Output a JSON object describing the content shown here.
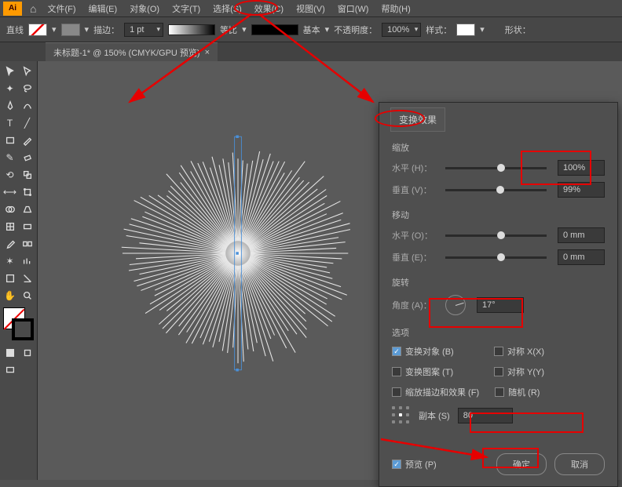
{
  "app_logo": "Ai",
  "menu": [
    "文件(F)",
    "编辑(E)",
    "对象(O)",
    "文字(T)",
    "选择(S)",
    "效果(C)",
    "视图(V)",
    "窗口(W)",
    "帮助(H)"
  ],
  "toolbar": {
    "line_label": "直线",
    "stroke_label": "描边：",
    "stroke_weight": "1 pt",
    "profile1": "等比",
    "profile2": "基本",
    "opacity_label": "不透明度：",
    "opacity": "100%",
    "style_label": "样式：",
    "shape_label": "形状："
  },
  "tab": {
    "title": "未标题-1* @ 150% (CMYK/GPU 预览)",
    "close": "×"
  },
  "dialog": {
    "title": "变换效果",
    "scale": {
      "title": "缩放",
      "h_label": "水平 (H)：",
      "h_val": "100%",
      "v_label": "垂直 (V)：",
      "v_val": "99%"
    },
    "move": {
      "title": "移动",
      "h_label": "水平 (O)：",
      "h_val": "0 mm",
      "v_label": "垂直 (E)：",
      "v_val": "0 mm"
    },
    "rotate": {
      "title": "旋转",
      "a_label": "角度 (A)：",
      "a_val": "17°"
    },
    "options": {
      "title": "选项",
      "transform_obj": "变换对象 (B)",
      "mirror_x": "对称 X(X)",
      "transform_pat": "变换图案 (T)",
      "mirror_y": "对称 Y(Y)",
      "scale_strokes": "缩放描边和效果 (F)",
      "random": "随机 (R)"
    },
    "copies_label": "副本 (S)",
    "copies_val": "80",
    "preview": "预览 (P)",
    "ok": "确定",
    "cancel": "取消"
  }
}
